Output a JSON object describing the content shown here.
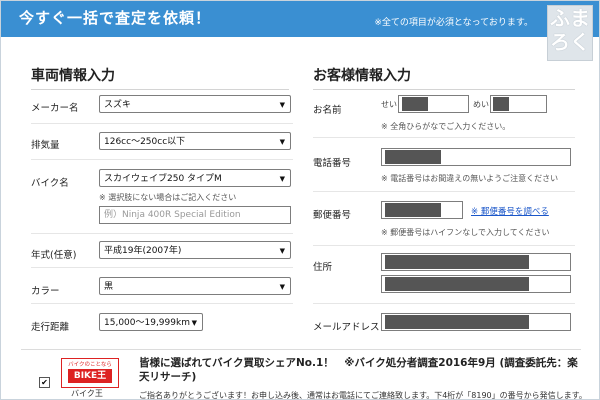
{
  "header": {
    "title": "今すぐ一括で査定を依頼！",
    "note": "※全ての項目が必須となっております。"
  },
  "logo": {
    "line1": "ふま",
    "line2": "ろく"
  },
  "vehicle": {
    "section_title": "車両情報入力",
    "maker": {
      "label": "メーカー名",
      "value": "スズキ"
    },
    "displacement": {
      "label": "排気量",
      "value": "126cc～250cc以下"
    },
    "bike": {
      "label": "バイク名",
      "value": "スカイウェイブ250 タイプM",
      "note": "※ 選択肢にない場合はご記入ください",
      "placeholder": "例）Ninja 400R Special Edition"
    },
    "year": {
      "label": "年式(任意)",
      "value": "平成19年(2007年)"
    },
    "color": {
      "label": "カラー",
      "value": "黒"
    },
    "mileage": {
      "label": "走行距離",
      "value": "15,000～19,999km"
    }
  },
  "customer": {
    "section_title": "お客様情報入力",
    "name": {
      "label": "お名前",
      "sei": "せい",
      "mei": "めい",
      "note": "※ 全角ひらがなでご入力ください。"
    },
    "phone": {
      "label": "電話番号",
      "note": "※ 電話番号はお間違えの無いようご注意ください"
    },
    "zip": {
      "label": "郵便番号",
      "link": "※ 郵便番号を調べる",
      "note": "※ 郵便番号はハイフンなしで入力してください"
    },
    "address": {
      "label": "住所"
    },
    "email": {
      "label": "メールアドレス"
    }
  },
  "bottom": {
    "checkbox": "✔",
    "logo_small": "バイクのことなら",
    "logo_big": "BIKE王",
    "company": "バイク王",
    "title": "皆様に選ばれてバイク買取シェアNo.1！　※バイク処分者調査2016年9月 (調査委託先：楽天リサーチ)",
    "text": "ご指名ありがとうございます！お申し込み後、通常はお電話にてご連絡致します。下4桁が「8190」の番号から発信します。"
  }
}
